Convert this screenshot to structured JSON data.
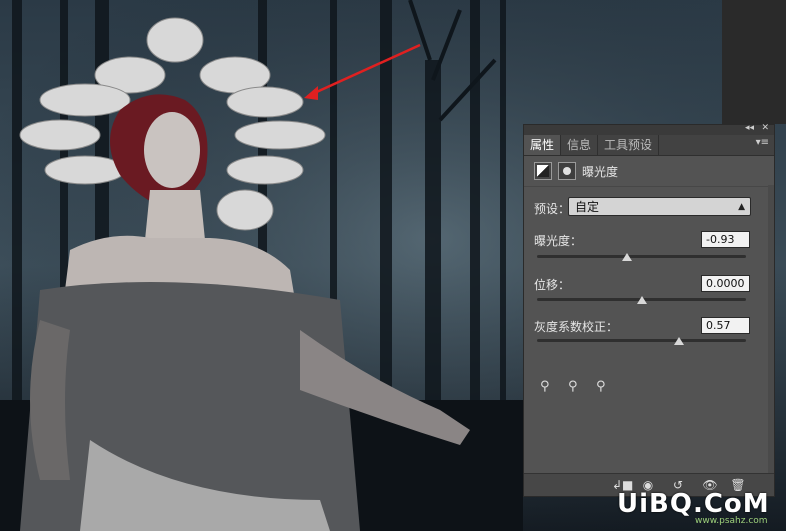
{
  "panel": {
    "collapse_icon": "double-chevron-left",
    "close_icon": "close-x",
    "tabs": [
      {
        "label": "属性",
        "active": true
      },
      {
        "label": "信息",
        "active": false
      },
      {
        "label": "工具预设",
        "active": false
      }
    ],
    "menu_icon": "panel-menu",
    "title": "曝光度",
    "preset_label": "预设：",
    "preset_value": "自定",
    "sliders": [
      {
        "label": "曝光度：",
        "value": "-0.93",
        "position": 0.43
      },
      {
        "label": "位移：",
        "value": "0.0000",
        "position": 0.5
      },
      {
        "label": "灰度系数校正：",
        "value": "0.57",
        "position": 0.68
      }
    ],
    "droppers": [
      "black-eyedropper-icon",
      "gray-eyedropper-icon",
      "white-eyedropper-icon"
    ],
    "bottom_icons": [
      "clip-to-layer-icon",
      "view-previous-icon",
      "reset-icon",
      "visibility-icon",
      "trash-icon"
    ]
  },
  "watermark": {
    "text": "UiBQ.CoM",
    "subtext": "www.psahz.com"
  },
  "colors": {
    "panel_bg": "#535353",
    "arrow": "#e02020"
  }
}
